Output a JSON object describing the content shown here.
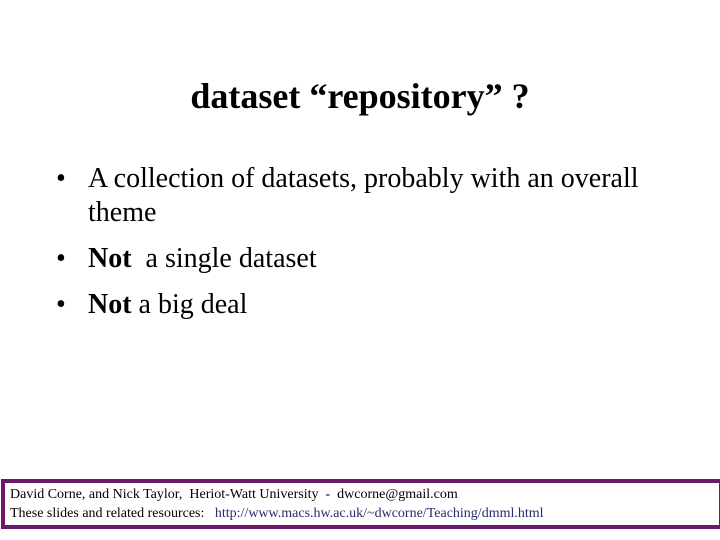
{
  "slide": {
    "title": "dataset “repository” ?",
    "bullets": [
      {
        "bold": "",
        "text": "A collection of datasets, probably with an overall theme"
      },
      {
        "bold": "Not",
        "text": "  a single dataset"
      },
      {
        "bold": "Not",
        "text": " a big deal"
      }
    ],
    "bullet_glyph": "•"
  },
  "footer": {
    "line1": "David Corne, and Nick Taylor,  Heriot-Watt University  -  dwcorne@gmail.com",
    "line2_label": "These slides and related resources:   ",
    "line2_link": "http://www.macs.hw.ac.uk/~dwcorne/Teaching/dmml.html",
    "border_color": "#6b1a6b",
    "link_color": "#2b2b6b"
  }
}
